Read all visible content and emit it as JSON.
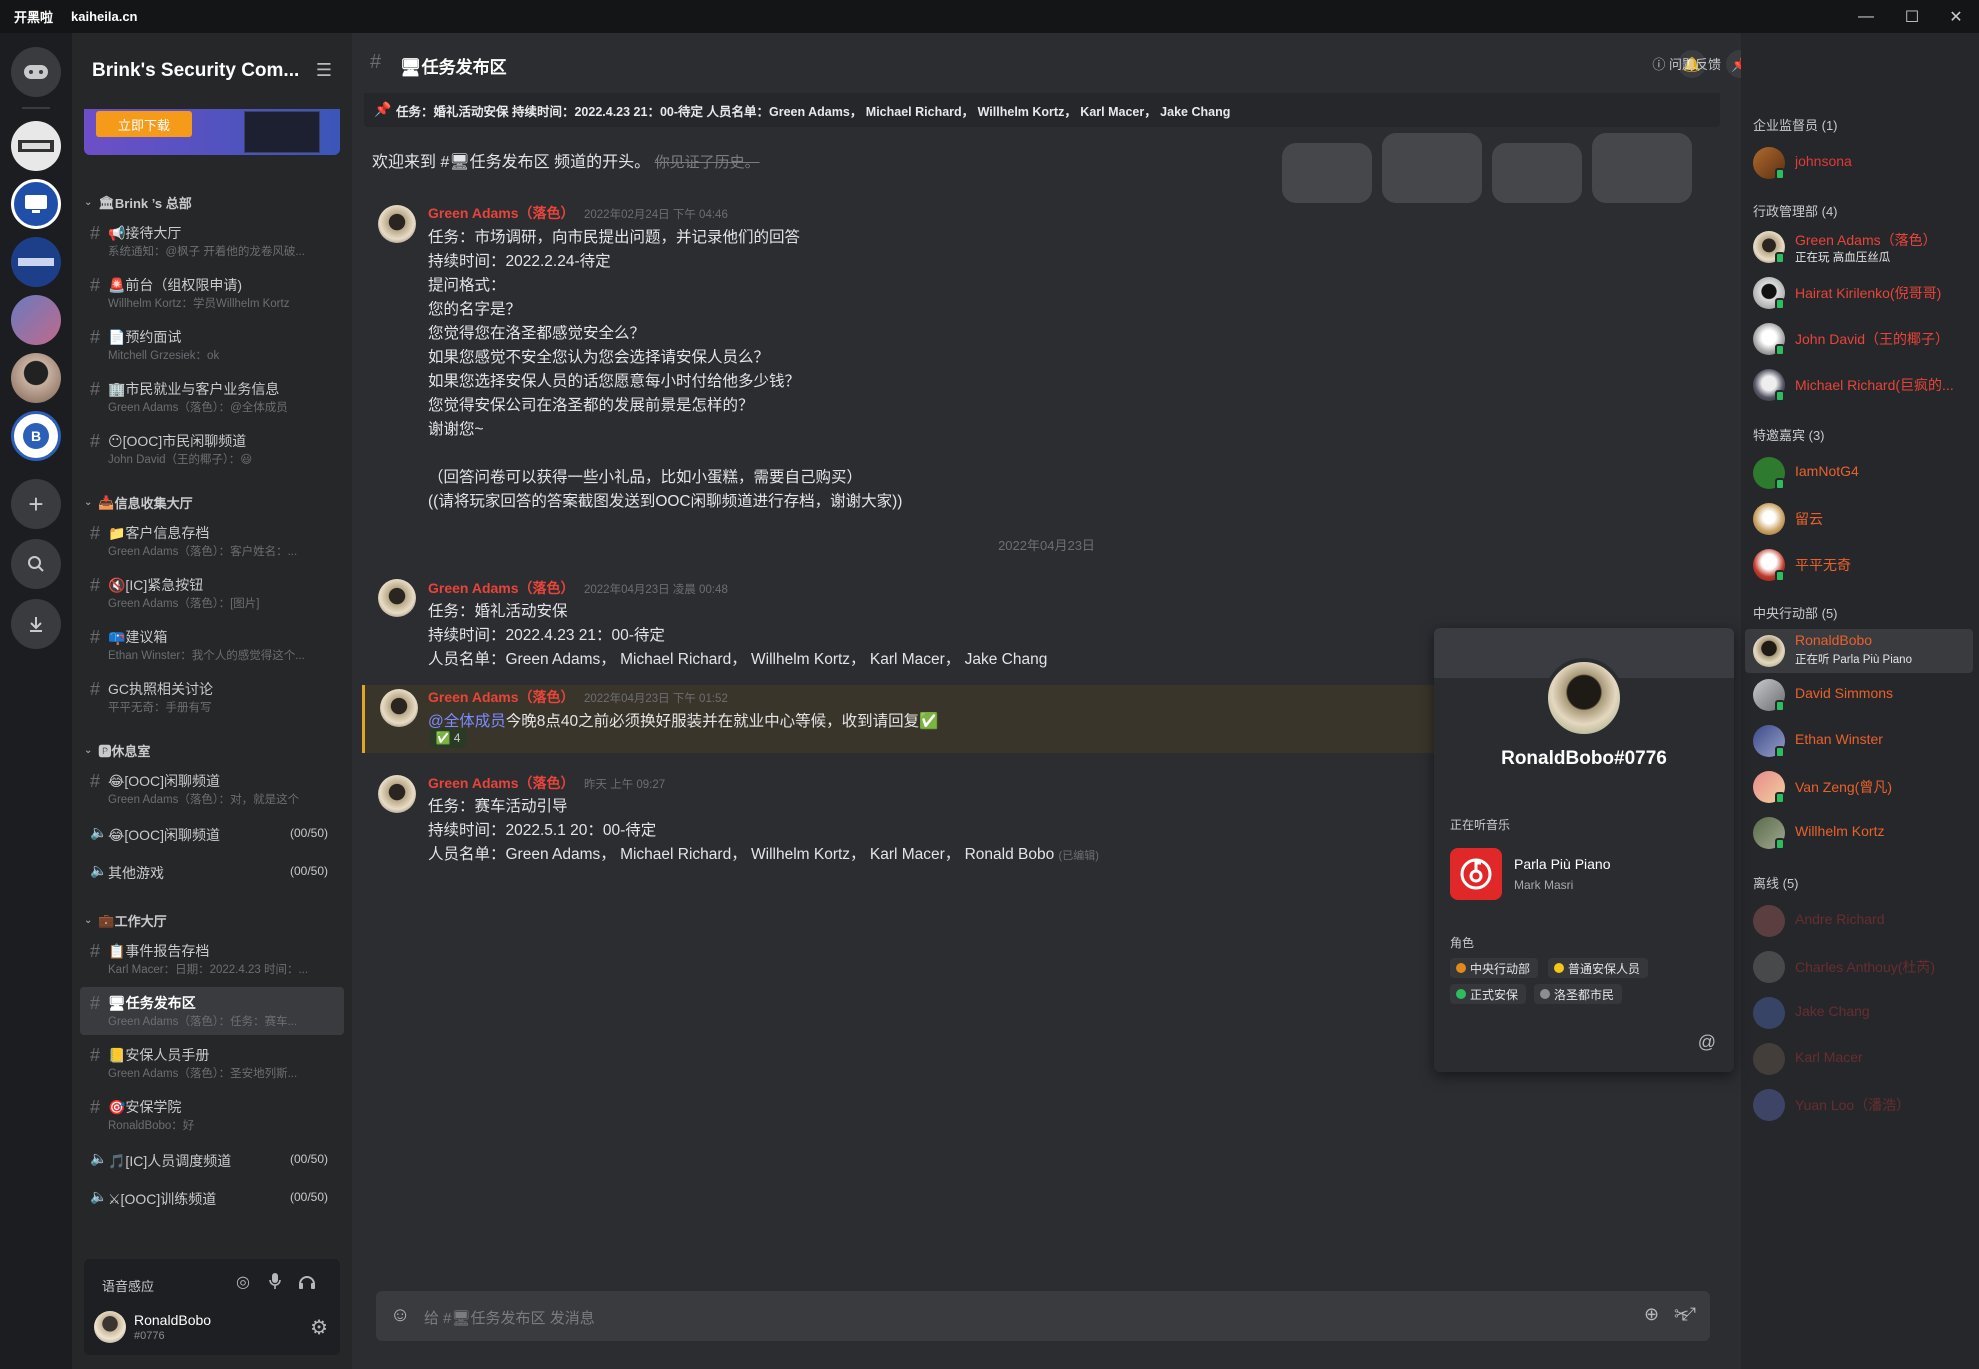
{
  "titlebar": {
    "app_name": "开黑啦",
    "domain": "kaiheila.cn",
    "minimize": "—",
    "maximize": "☐",
    "close": "✕"
  },
  "server": {
    "name": "Brink's Security Com...",
    "banner_button": "立即下载"
  },
  "categories": [
    {
      "label": "Brink ’s 总部"
    },
    {
      "label": "信息收集大厅"
    },
    {
      "label": "休息室"
    },
    {
      "label": "工作大厅"
    }
  ],
  "channels": [
    {
      "name": "📢接待大厅",
      "preview": "系统通知：@枫子 开着他的龙卷风破..."
    },
    {
      "name": "🚨前台（组权限申请)",
      "preview": "Willhelm Kortz：学员Willhelm Kortz"
    },
    {
      "name": "📄预约面试",
      "preview": "Mitchell Grzesiek：ok"
    },
    {
      "name": "🏢市民就业与客户业务信息",
      "preview": "Green Adams（落色）：@全体成员"
    },
    {
      "name": "😶[OOC]市民闲聊频道",
      "preview": "John David（王的椰子）：😃"
    },
    {
      "name": "📁客户信息存档",
      "preview": "Green Adams（落色）：客户姓名：..."
    },
    {
      "name": "🔇[IC]紧急按钮",
      "preview": "Green Adams（落色）：[图片]"
    },
    {
      "name": "📪建议箱",
      "preview": "Ethan Winster：我个人的感觉得这个..."
    },
    {
      "name": "GC执照相关讨论",
      "preview": "平平无奇：手册有写"
    },
    {
      "name": "😂[OOC]闲聊频道",
      "preview": "Green Adams（落色）：对，就是这个"
    },
    {
      "name": "📋事件报告存档",
      "preview": "Karl Macer：日期：2022.4.23 时间：..."
    },
    {
      "name": "🖥任务发布区",
      "preview": "Green Adams（落色）：任务：赛车..."
    },
    {
      "name": "📒安保人员手册",
      "preview": "Green Adams（落色）：圣安地列斯..."
    },
    {
      "name": "🎯安保学院",
      "preview": "RonaldBobo：好"
    }
  ],
  "voice_channels": [
    {
      "name": "😂[OOC]闲聊频道",
      "count": "(00/50)"
    },
    {
      "name": "其他游戏",
      "count": "(00/50)"
    },
    {
      "name": "🎵[IC]人员调度频道",
      "count": "(00/50)"
    },
    {
      "name": "⚔[OOC]训练频道",
      "count": "(00/50)"
    }
  ],
  "user_panel": {
    "voice_label": "语音感应",
    "username": "RonaldBobo",
    "tag": "#0776"
  },
  "main": {
    "channel_title": "🖥任务发布区",
    "pinned": "任务：婚礼活动安保 持续时间：2022.4.23 21：00-待定 人员名单：Green Adams， Michael Richard， Willhelm Kortz， Karl Macer， Jake Chang",
    "feedback": "问题反馈",
    "welcome_text": "欢迎来到 #🖥任务发布区 频道的开头。",
    "welcome_hist": "你见证了历史。",
    "date_separator": "2022年04月23日",
    "composer_placeholder": "给 #🖥任务发布区 发消息"
  },
  "messages": [
    {
      "author": "Green Adams（落色）",
      "time": "2022年02月24日 下午 04:46",
      "lines": [
        "任务：市场调研，向市民提出问题，并记录他们的回答",
        "持续时间：2022.2.24-待定",
        "提问格式：",
        "您的名字是？",
        "您觉得您在洛圣都感觉安全么？",
        "如果您感觉不安全您认为您会选择请安保人员么？",
        "如果您选择安保人员的话您愿意每小时付给他多少钱？",
        "您觉得安保公司在洛圣都的发展前景是怎样的？",
        "谢谢您~",
        "",
        "（回答问卷可以获得一些小礼品，比如小蛋糕，需要自己购买）",
        "((请将玩家回答的答案截图发送到OOC闲聊频道进行存档，谢谢大家))"
      ]
    },
    {
      "author": "Green Adams（落色）",
      "time": "2022年04月23日 凌晨 00:48",
      "lines": [
        "任务：婚礼活动安保",
        "持续时间：2022.4.23 21：00-待定",
        "人员名单：Green Adams， Michael Richard， Willhelm Kortz， Karl Macer， Jake Chang"
      ]
    },
    {
      "author": "Green Adams（落色）",
      "time": "2022年04月23日 下午 01:52",
      "mention": "@全体成员",
      "text": "今晚8点40之前必须换好服装并在就业中心等候，收到请回复✅",
      "reaction": "✅ 4"
    },
    {
      "author": "Green Adams（落色）",
      "time": "昨天 上午 09:27",
      "lines": [
        "任务：赛车活动引导",
        "持续时间：2022.5.1 20：00-待定",
        "人员名单：Green Adams， Michael Richard， Willhelm Kortz， Karl Macer， Ronald Bobo"
      ],
      "edited": "(已编辑)"
    }
  ],
  "members": {
    "groups": [
      {
        "label": "企业监督员 (1)"
      },
      {
        "label": "行政管理部 (4)"
      },
      {
        "label": "特邀嘉宾 (3)"
      },
      {
        "label": "中央行动部 (5)"
      },
      {
        "label": "离线 (5)"
      }
    ],
    "list": [
      {
        "name": "johnsona"
      },
      {
        "name": "Green Adams（落色）",
        "status": "正在玩 高血压丝瓜"
      },
      {
        "name": "Hairat Kirilenko(倪哥哥)"
      },
      {
        "name": "John David（王的椰子）"
      },
      {
        "name": "Michael Richard(巨疯的..."
      },
      {
        "name": "IamNotG4"
      },
      {
        "name": "留云"
      },
      {
        "name": "平平无奇"
      },
      {
        "name": "RonaldBobo",
        "status": "正在听 Parla Più Piano"
      },
      {
        "name": "David Simmons"
      },
      {
        "name": "Ethan Winster"
      },
      {
        "name": "Van Zeng(曾凡)"
      },
      {
        "name": "Willhelm Kortz"
      },
      {
        "name": "Andre Richard"
      },
      {
        "name": "Charles Anthouy(杜芮)"
      },
      {
        "name": "Jake Chang"
      },
      {
        "name": "Karl Macer"
      },
      {
        "name": "Yuan Loo（潘浩）"
      }
    ]
  },
  "popup": {
    "name": "RonaldBobo#0776",
    "listening_label": "正在听音乐",
    "song": "Parla Più Piano",
    "artist": "Mark Masri",
    "roles_label": "角色",
    "roles": [
      {
        "name": "中央行动部",
        "color": "#e08a1a"
      },
      {
        "name": "普通安保人员",
        "color": "#f5c518"
      },
      {
        "name": "正式安保",
        "color": "#2ebd5e"
      },
      {
        "name": "洛圣都市民",
        "color": "#8c8e92"
      }
    ]
  }
}
